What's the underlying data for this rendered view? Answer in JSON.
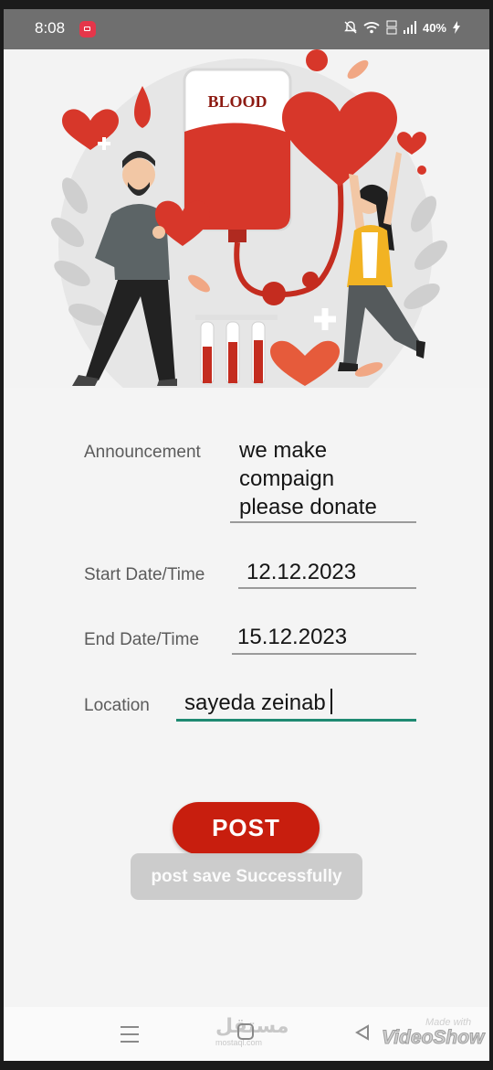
{
  "status_bar": {
    "time": "8:08",
    "battery": "40%",
    "icons": [
      "screen-record-icon",
      "mute-icon",
      "wifi-icon",
      "volte-icon",
      "signal-icon",
      "charging-icon"
    ]
  },
  "hero": {
    "illustration": "blood-donation-illustration",
    "bag_label": "BLOOD"
  },
  "form": {
    "announcement": {
      "label": "Announcement",
      "value_lines": [
        "we make",
        "compaign",
        "please donate"
      ]
    },
    "start": {
      "label": "Start Date/Time",
      "value": "12.12.2023"
    },
    "end": {
      "label": "End Date/Time",
      "value": "15.12.2023"
    },
    "location": {
      "label": "Location",
      "value": "sayeda zeinab"
    }
  },
  "post_button": {
    "label": "POST",
    "color": "#c81e0e"
  },
  "toast": {
    "text": "post save Successfully"
  },
  "nav_bar": {
    "icons": [
      "recent-apps-icon",
      "home-icon",
      "back-icon"
    ],
    "watermark_ar": "مستقل",
    "watermark_en": "mostaql.com",
    "made_with": "Made with",
    "brand": "VideoShow"
  },
  "colors": {
    "accent": "#1f8a72",
    "blood_red": "#d7372a",
    "status_bar": "#6f6f6f"
  }
}
